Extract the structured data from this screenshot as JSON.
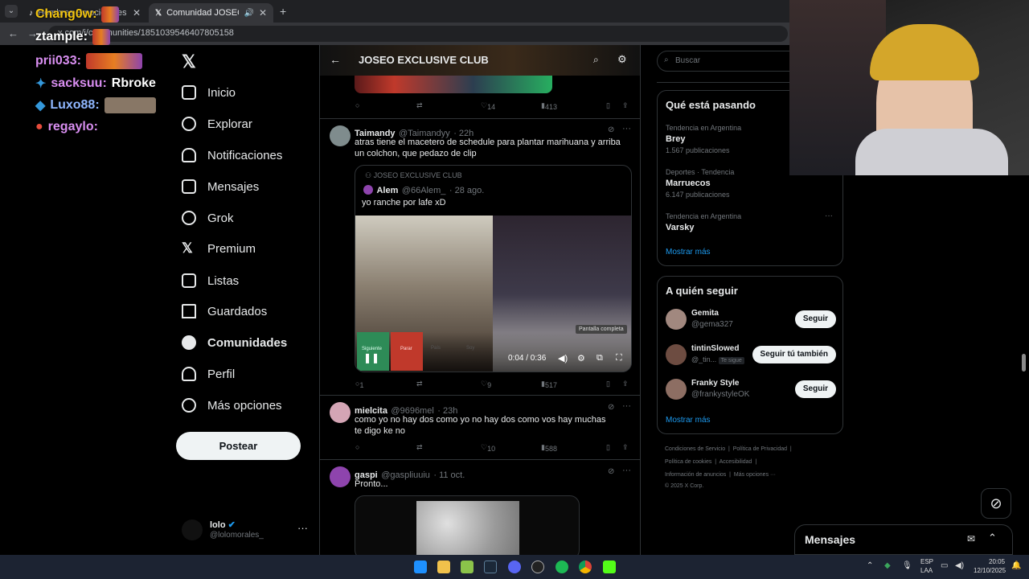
{
  "browser": {
    "tabs": [
      {
        "label": "Hombres Emocionales: Relaci...",
        "active": false
      },
      {
        "label": "Comunidad JOSEO EXCLUSIVE",
        "active": true
      }
    ],
    "address": "x.com/i/communities/1851039546407805158"
  },
  "overlay_chat": [
    {
      "user": "Chang0w:",
      "color": "#f1c40f"
    },
    {
      "user": "ztample:",
      "color": "#ffffff"
    },
    {
      "user": "prii033:",
      "color": "#d88ef0"
    },
    {
      "user": "sacksuu:",
      "message": "Rbroke",
      "color": "#d88ef0"
    },
    {
      "user": "Luxo88:",
      "color": "#8fb7ff"
    },
    {
      "user": "regaylo:",
      "color": "#d88ef0"
    }
  ],
  "nav": {
    "items": [
      {
        "label": "Inicio",
        "icon": "home-icon"
      },
      {
        "label": "Explorar",
        "icon": "search-icon"
      },
      {
        "label": "Notificaciones",
        "icon": "bell-icon"
      },
      {
        "label": "Mensajes",
        "icon": "mail-icon"
      },
      {
        "label": "Grok",
        "icon": "grok-icon"
      },
      {
        "label": "Premium",
        "icon": "x-icon"
      },
      {
        "label": "Listas",
        "icon": "list-icon"
      },
      {
        "label": "Guardados",
        "icon": "bookmark-icon"
      },
      {
        "label": "Comunidades",
        "icon": "people-icon"
      },
      {
        "label": "Perfil",
        "icon": "person-icon"
      },
      {
        "label": "Más opciones",
        "icon": "more-icon"
      }
    ],
    "post_label": "Postear",
    "account_name": "lolo",
    "account_handle": "@lolomorales_"
  },
  "community": {
    "title": "JOSEO EXCLUSIVE CLUB"
  },
  "tweets": [
    {
      "stats": {
        "replies": "",
        "retweets": "",
        "likes": "14",
        "views": "413"
      }
    },
    {
      "name": "Taimandy",
      "handle": "@Taimandyy",
      "time": "· 22h",
      "text": "atras tiene el macetero de schedule para plantar marihuana y arriba un colchon, que pedazo de clip",
      "quote": {
        "community": "JOSEO EXCLUSIVE CLUB",
        "name": "Alem",
        "handle": "@66Alem_",
        "time": "· 28 ago.",
        "text": "yo ranche por lafe xD"
      },
      "video": {
        "time": "0:04 / 0:36",
        "tooltip": "Pantalla completa",
        "overlay_labels": [
          "Siguiente",
          "Parar",
          "País",
          "Soy"
        ]
      },
      "stats": {
        "replies": "1",
        "retweets": "",
        "likes": "9",
        "views": "517"
      }
    },
    {
      "name": "mielcita",
      "handle": "@9696mel",
      "time": "· 23h",
      "text": "como yo no hay dos como yo no hay dos como vos hay muchas te digo ke no",
      "stats": {
        "replies": "",
        "retweets": "",
        "likes": "10",
        "views": "588"
      }
    },
    {
      "name": "gaspi",
      "handle": "@gaspliuuiu",
      "time": "· 11 oct.",
      "text": "Pronto..."
    }
  ],
  "right": {
    "search_placeholder": "Buscar",
    "trending_title": "Qué está pasando",
    "trends": [
      {
        "context": "Tendencia en Argentina",
        "name": "Brey",
        "count": "1.567 publicaciones"
      },
      {
        "context": "Deportes · Tendencia",
        "name": "Marruecos",
        "count": "6.147 publicaciones"
      },
      {
        "context": "Tendencia en Argentina",
        "name": "Varsky",
        "count": ""
      }
    ],
    "show_more": "Mostrar más",
    "follow_title": "A quién seguir",
    "follow": [
      {
        "name": "Gemita",
        "handle": "@gema327",
        "button": "Seguir",
        "badge": ""
      },
      {
        "name": "tintinSlowed",
        "handle": "@_tin...",
        "button": "Seguir tú también",
        "badge": "Te sigue"
      },
      {
        "name": "Franky Style",
        "handle": "@frankystyleOK",
        "button": "Seguir",
        "badge": ""
      }
    ],
    "footer": [
      "Condiciones de Servicio",
      "Política de Privacidad",
      "Política de cookies",
      "Accesibilidad",
      "Información de anuncios",
      "Más opciones ···",
      "© 2025 X Corp."
    ]
  },
  "messages_drawer": {
    "title": "Mensajes"
  },
  "taskbar": {
    "lang": "ESP",
    "lang2": "LAA",
    "time": "20:05",
    "date": "12/10/2025"
  },
  "colors": {
    "accent": "#1d9bf0",
    "border": "#2f3336",
    "muted": "#71767b"
  }
}
